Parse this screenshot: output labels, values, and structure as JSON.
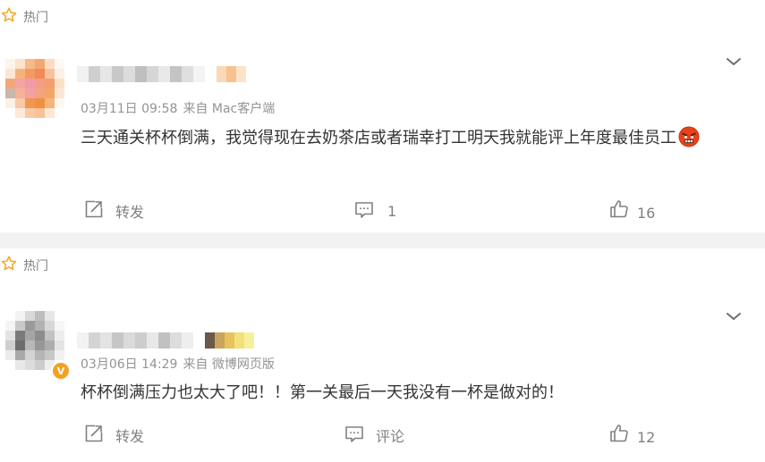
{
  "posts": [
    {
      "hot_label": "热门",
      "time": "03月11日 09:58",
      "source": "来自 Mac客户端",
      "content": "三天通关杯杯倒满，我觉得现在去奶茶店或者瑞幸打工明天我就能评上年度最佳员工",
      "content_emoji": "angry-emoji",
      "forward_label": "转发",
      "comment_label": "1",
      "like_count": "16"
    },
    {
      "hot_label": "热门",
      "time": "03月06日 14:29",
      "source": "来自 微博网页版",
      "content": "杯杯倒满压力也太大了吧！！第一关最后一天我没有一杯是做对的！",
      "forward_label": "转发",
      "comment_label": "评论",
      "like_count": "12"
    }
  ],
  "colors": {
    "hot_star": "#f5a623",
    "meta_text": "#939393",
    "icon_gray": "#808080",
    "verified_badge": "#f3a122",
    "separator": "#f2f2f2"
  },
  "icons": [
    "star-icon",
    "chevron-down-icon",
    "forward-icon",
    "comment-icon",
    "thumbs-up-icon",
    "verified-icon"
  ]
}
